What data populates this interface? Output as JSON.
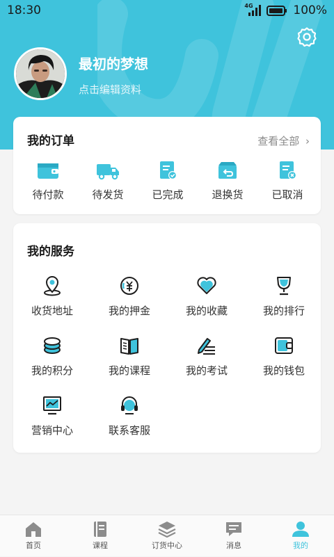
{
  "status_bar": {
    "time": "18:30",
    "network": "4G",
    "battery": "100%"
  },
  "profile": {
    "name": "最初的梦想",
    "edit_label": "点击编辑资料"
  },
  "orders": {
    "title": "我的订单",
    "view_all": "查看全部",
    "items": [
      {
        "label": "待付款",
        "icon": "wallet-icon"
      },
      {
        "label": "待发货",
        "icon": "truck-icon"
      },
      {
        "label": "已完成",
        "icon": "completed-doc-icon"
      },
      {
        "label": "退换货",
        "icon": "return-box-icon"
      },
      {
        "label": "已取消",
        "icon": "cancelled-doc-icon"
      }
    ]
  },
  "services": {
    "title": "我的服务",
    "items": [
      {
        "label": "收货地址",
        "icon": "location-icon"
      },
      {
        "label": "我的押金",
        "icon": "deposit-icon"
      },
      {
        "label": "我的收藏",
        "icon": "heart-icon"
      },
      {
        "label": "我的排行",
        "icon": "trophy-icon"
      },
      {
        "label": "我的积分",
        "icon": "coins-icon"
      },
      {
        "label": "我的课程",
        "icon": "book-icon"
      },
      {
        "label": "我的考试",
        "icon": "exam-pen-icon"
      },
      {
        "label": "我的钱包",
        "icon": "wallet-icon"
      },
      {
        "label": "营销中心",
        "icon": "chart-monitor-icon"
      },
      {
        "label": "联系客服",
        "icon": "headset-icon"
      }
    ]
  },
  "tabbar": {
    "items": [
      {
        "label": "首页",
        "icon": "home-icon"
      },
      {
        "label": "课程",
        "icon": "book-icon"
      },
      {
        "label": "订货中心",
        "icon": "layers-icon"
      },
      {
        "label": "消息",
        "icon": "message-icon"
      },
      {
        "label": "我的",
        "icon": "user-icon"
      }
    ],
    "active_index": 4
  },
  "colors": {
    "accent": "#3fc3dc",
    "icon_dark": "#1e1e1e"
  }
}
